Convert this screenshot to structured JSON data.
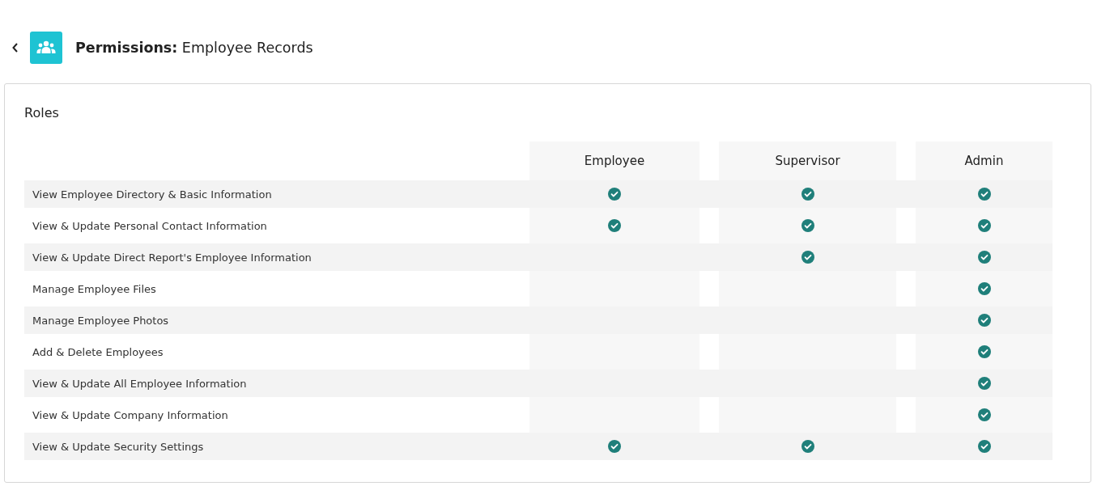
{
  "header": {
    "title": "**Permissions:** Employee Records"
  },
  "card": {
    "title": "Roles",
    "roles": [
      "Employee",
      "Supervisor",
      "Admin"
    ],
    "rows": [
      {
        "label": "View Employee Directory & Basic Information",
        "allowed": [
          true,
          true,
          true
        ]
      },
      {
        "label": "View & Update Personal Contact Information",
        "allowed": [
          true,
          true,
          true
        ]
      },
      {
        "label": "View & Update Direct Report's Employee Information",
        "allowed": [
          false,
          true,
          true
        ]
      },
      {
        "label": "Manage Employee Files",
        "allowed": [
          false,
          false,
          true
        ]
      },
      {
        "label": "Manage Employee Photos",
        "allowed": [
          false,
          false,
          true
        ]
      },
      {
        "label": "Add & Delete Employees",
        "allowed": [
          false,
          false,
          true
        ]
      },
      {
        "label": "View & Update All Employee Information",
        "allowed": [
          false,
          false,
          true
        ]
      },
      {
        "label": "View & Update Company Information",
        "allowed": [
          false,
          false,
          true
        ]
      },
      {
        "label": "View & Update Security Settings",
        "allowed": [
          true,
          true,
          true
        ]
      }
    ]
  }
}
